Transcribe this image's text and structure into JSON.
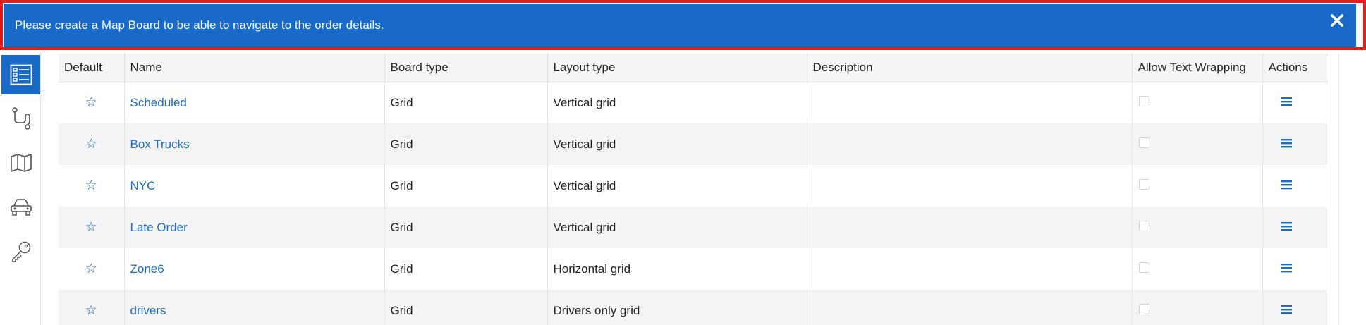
{
  "banner": {
    "message": "Please create a Map Board to be able to navigate to the order details.",
    "close_icon": "close-icon",
    "background": "#1869c8",
    "frame_color": "#e0201c"
  },
  "rail": {
    "items": [
      {
        "icon": "board-list-icon",
        "active": true
      },
      {
        "icon": "route-icon",
        "active": false
      },
      {
        "icon": "map-icon",
        "active": false
      },
      {
        "icon": "car-icon",
        "active": false
      },
      {
        "icon": "key-icon",
        "active": false
      }
    ]
  },
  "table": {
    "headers": [
      "Default",
      "Name",
      "Board type",
      "Layout type",
      "Description",
      "Allow Text Wrapping",
      "Actions"
    ],
    "rows": [
      {
        "name": "Scheduled",
        "board_type": "Grid",
        "layout_type": "Vertical grid",
        "description": ""
      },
      {
        "name": "Box Trucks",
        "board_type": "Grid",
        "layout_type": "Vertical grid",
        "description": ""
      },
      {
        "name": "NYC",
        "board_type": "Grid",
        "layout_type": "Vertical grid",
        "description": ""
      },
      {
        "name": "Late Order",
        "board_type": "Grid",
        "layout_type": "Vertical grid",
        "description": ""
      },
      {
        "name": "Zone6",
        "board_type": "Grid",
        "layout_type": "Horizontal grid",
        "description": ""
      },
      {
        "name": "drivers",
        "board_type": "Grid",
        "layout_type": "Drivers only grid",
        "description": ""
      }
    ]
  }
}
